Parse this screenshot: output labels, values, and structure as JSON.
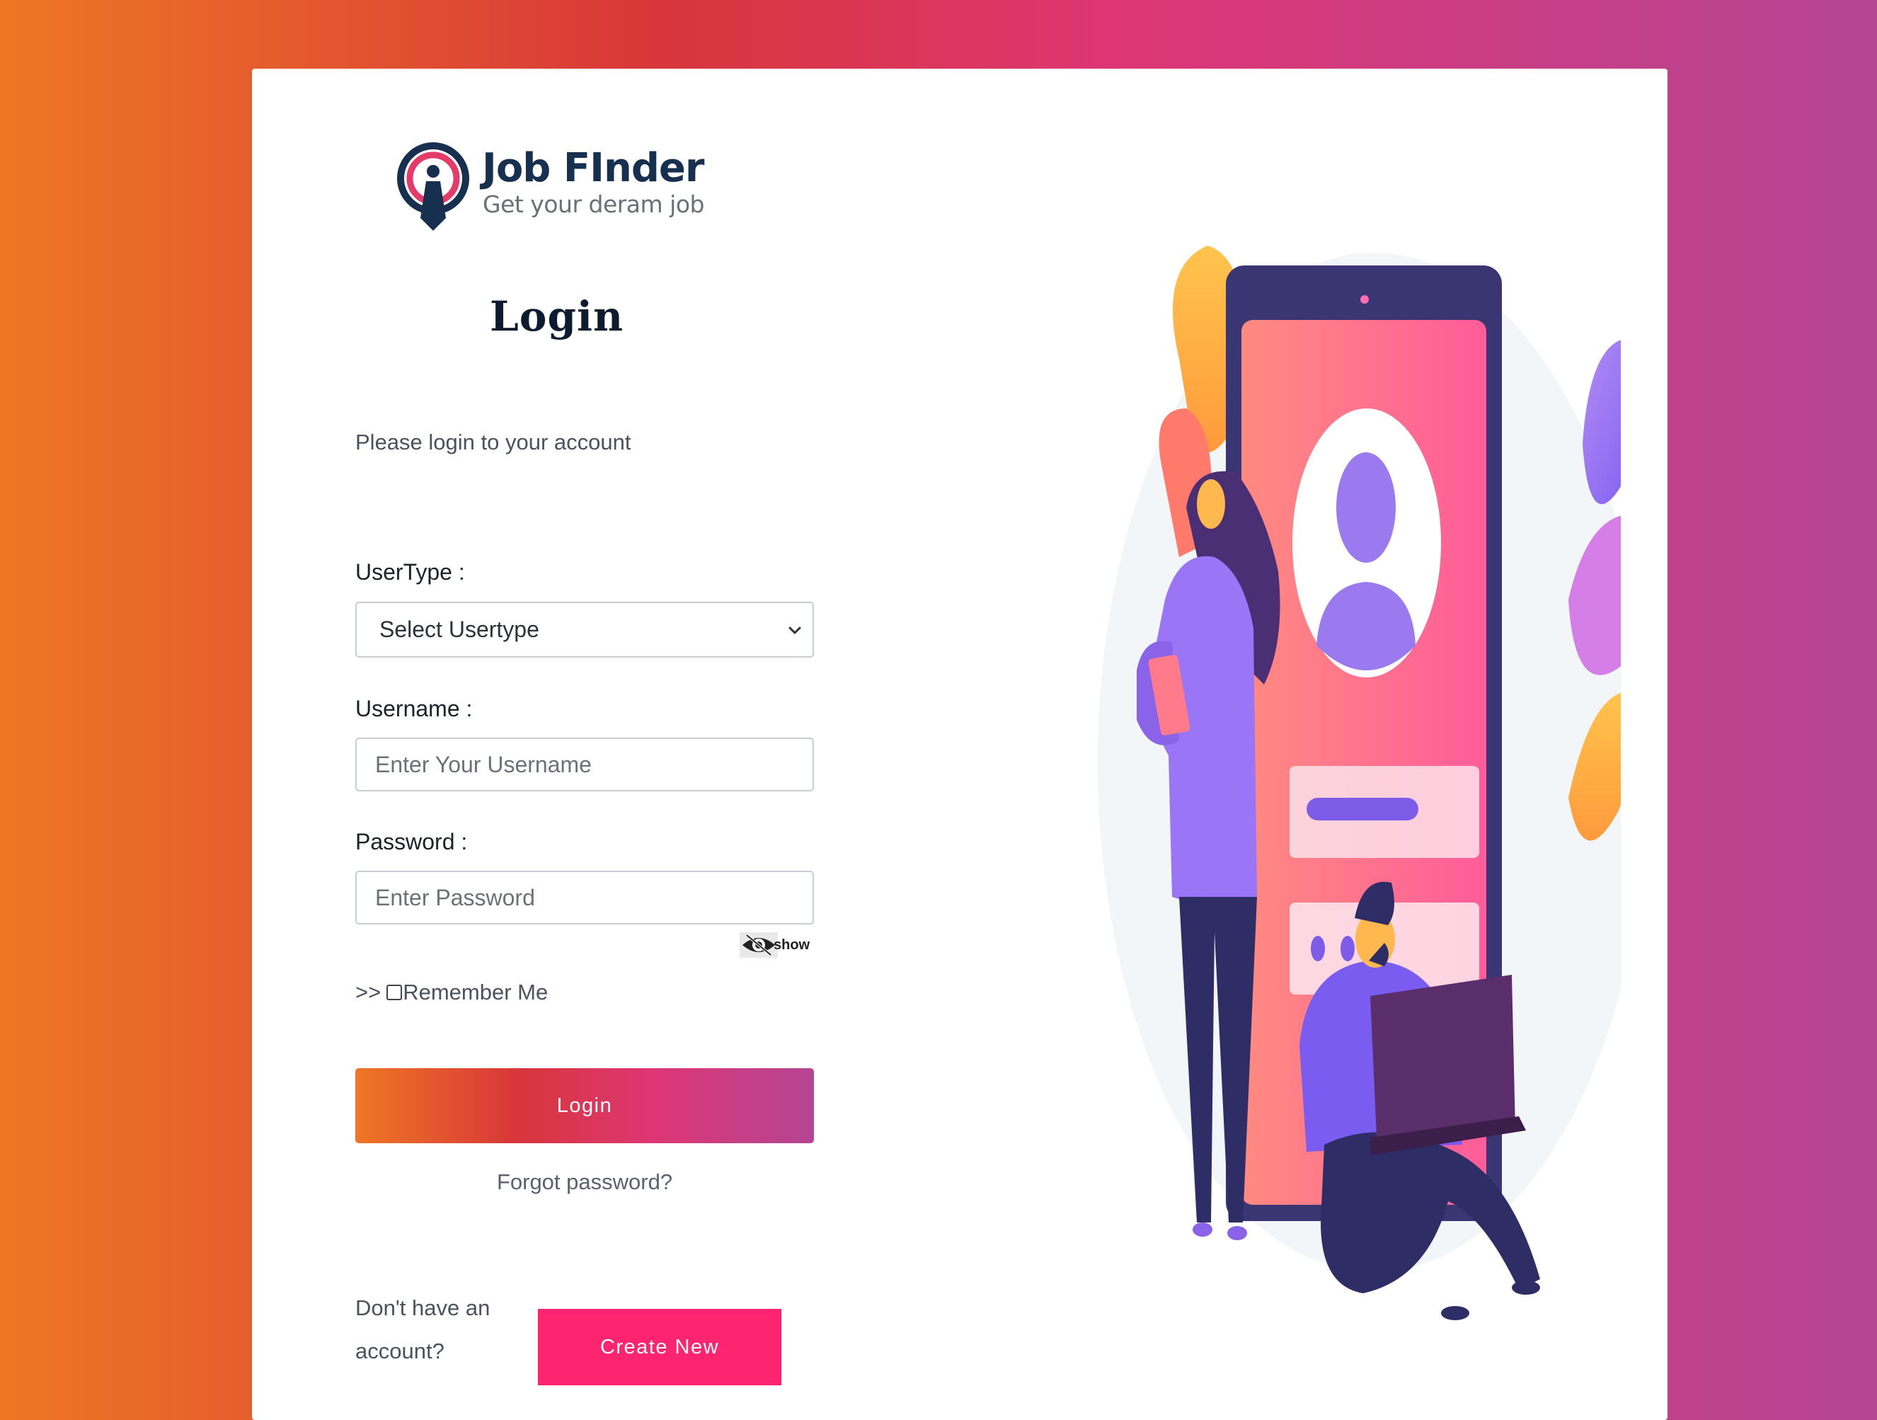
{
  "brand": {
    "name": "Job FInder",
    "tagline": "Get your deram job"
  },
  "login_form": {
    "heading": "Login",
    "intro": "Please login to your account",
    "usertype": {
      "label": "UserType :",
      "selected": "Select Usertype"
    },
    "username": {
      "label": "Username :",
      "placeholder": "Enter Your Username"
    },
    "password": {
      "label": "Password :",
      "placeholder": "Enter Password"
    },
    "show_toggle": "show",
    "remember_prefix": ">>",
    "remember_label": "Remember Me",
    "submit_label": "Login",
    "forgot_link": "Forgot password?"
  },
  "signup": {
    "prompt": "Don't have an account?",
    "button_label": "Create New"
  },
  "colors": {
    "gradient": [
      "#ee7724",
      "#d8363a",
      "#dd3675",
      "#b44593"
    ],
    "create_button": "#ff2470",
    "brand_navy": "#18304f"
  },
  "icons": {
    "logo": "job-finder-logo-icon",
    "password_toggle": "eye-slash-icon",
    "select_chevron": "chevron-down-icon"
  }
}
